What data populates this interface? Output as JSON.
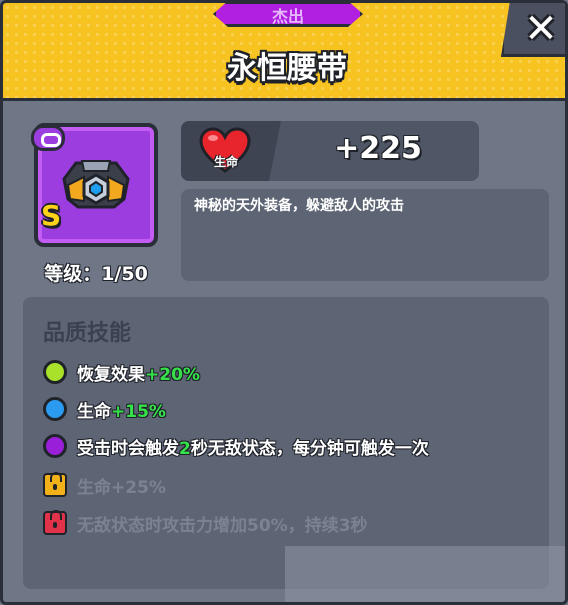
{
  "rarity": "杰出",
  "title": "永恒腰带",
  "item": {
    "grade": "S",
    "level_label": "等级：1/50"
  },
  "stat": {
    "label": "生命",
    "value": "+225"
  },
  "description": "神秘的天外装备，躲避敌人的攻击",
  "skills": {
    "title": "品质技能",
    "unlocked": [
      {
        "color": "#a8e02a",
        "pre": "恢复效果",
        "highlight": "+20%",
        "post": ""
      },
      {
        "color": "#2a9bf0",
        "pre": "生命",
        "highlight": "+15%",
        "post": ""
      },
      {
        "color": "#9a1fd8",
        "pre": "受击时会触发",
        "highlight": "2",
        "post": "秒无敌状态，每分钟可触发一次"
      }
    ],
    "locked": [
      {
        "color": "#f2b019",
        "text": "生命+25%"
      },
      {
        "color": "#e0334a",
        "text": "无敌状态时攻击力增加50%，持续3秒"
      }
    ]
  },
  "colors": {
    "header": "#f7c321",
    "rarity": "#b11fe0",
    "panel": "#6f7686",
    "highlight": "#35e24a"
  },
  "icons": [
    "close-icon",
    "belt-icon",
    "heart-icon",
    "lock-icon"
  ]
}
